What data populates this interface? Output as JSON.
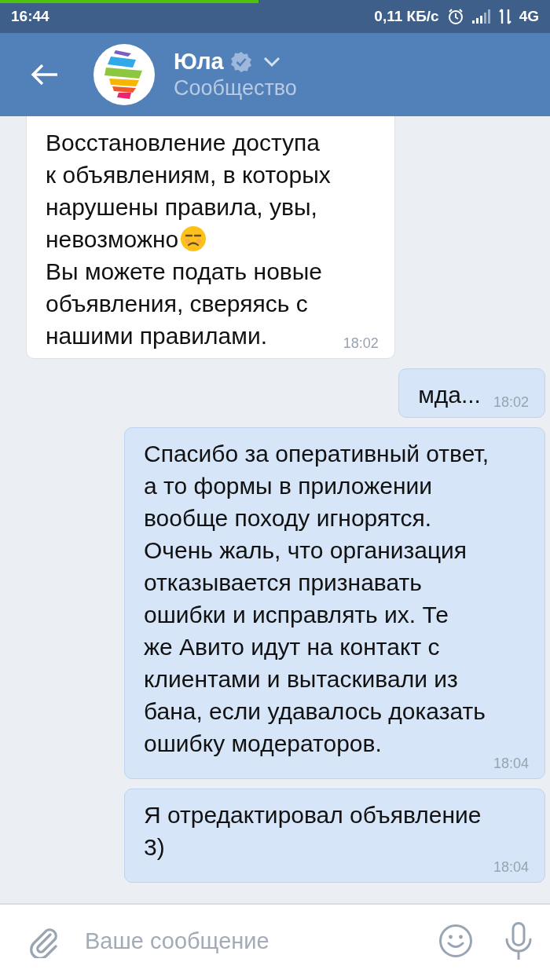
{
  "status_bar": {
    "time": "16:44",
    "speed": "0,11 КБ/с",
    "network": "4G",
    "loading": {
      "level": 0.47
    }
  },
  "header": {
    "name": "Юла",
    "verified": true,
    "subtitle": "Сообщество"
  },
  "messages": [
    {
      "incoming": true,
      "paragraphs": [
        {
          "text": "Восстановление доступа\nк объявлениям, в которых\nнарушены правила, увы,",
          "emoji": false
        },
        {
          "text": "невозможно",
          "emoji": true
        },
        {
          "text": "Вы можете подать новые\nобъявления, сверяясь с\nнашими правилами.",
          "emoji": false
        }
      ],
      "time": "18:02"
    },
    {
      "incoming": false,
      "paragraphs": [
        {
          "text": "мда...",
          "emoji": false
        }
      ],
      "time": "18:02"
    },
    {
      "incoming": false,
      "paragraphs": [
        {
          "text": "Спасибо за оперативный ответ,\nа то формы в приложении\nвообще походу игнорятся.\nОчень жаль, что организация\nотказывается признавать\nошибки и исправлять их. Те\nже Авито идут на контакт с\nклиентами и вытаскивали из\nбана, если удавалось доказать\nошибку модераторов.",
          "emoji": false
        }
      ],
      "time": "18:04"
    },
    {
      "incoming": false,
      "paragraphs": [
        {
          "text": "Я отредактировал объявление\n3)",
          "emoji": false
        }
      ],
      "time": "18:04"
    }
  ],
  "composer": {
    "placeholder": "Ваше сообщение"
  }
}
